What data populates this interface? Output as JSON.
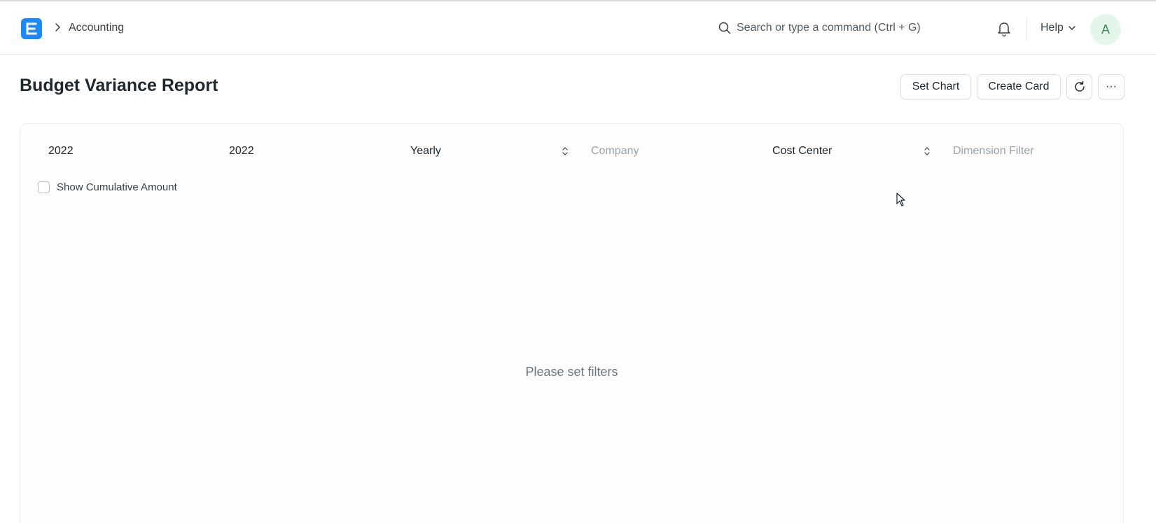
{
  "navbar": {
    "breadcrumb": "Accounting",
    "search_placeholder": "Search or type a command (Ctrl + G)",
    "help_label": "Help",
    "avatar_initial": "A"
  },
  "page": {
    "title": "Budget Variance Report",
    "buttons": {
      "set_chart": "Set Chart",
      "create_card": "Create Card",
      "more": "···"
    }
  },
  "filters": {
    "from_fiscal_year": "2022",
    "to_fiscal_year": "2022",
    "period": "Yearly",
    "company_placeholder": "Company",
    "budget_against": "Cost Center",
    "dimension_placeholder": "Dimension Filter",
    "show_cumulative_label": "Show Cumulative Amount",
    "show_cumulative_checked": false
  },
  "report": {
    "empty_message": "Please set filters"
  },
  "colors": {
    "brand": "#1e88f4",
    "avatar_bg": "#e4f5e9",
    "avatar_fg": "#3e8f5a"
  },
  "icons": [
    "app-logo-icon",
    "chevron-right-icon",
    "search-icon",
    "bell-icon",
    "chevron-down-icon",
    "refresh-icon",
    "select-arrows-icon",
    "mouse-cursor-icon"
  ]
}
